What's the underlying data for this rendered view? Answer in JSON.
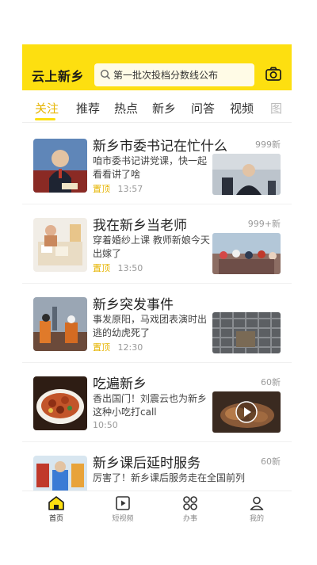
{
  "header": {
    "logo": "云上新乡",
    "search_text": "第一批次投档分数线公布"
  },
  "tabs": [
    "关注",
    "推荐",
    "热点",
    "新乡",
    "问答",
    "视频",
    "图"
  ],
  "feed": [
    {
      "title": "新乡市委书记在忙什么",
      "count": "999新",
      "desc": "咱市委书记讲党课，快一起看看讲了啥",
      "pin": "置顶",
      "time": "13:57"
    },
    {
      "title": "我在新乡当老师",
      "count": "999+新",
      "desc": "穿着婚纱上课 教师新娘今天出嫁了",
      "pin": "置顶",
      "time": "13:50"
    },
    {
      "title": "新乡突发事件",
      "count": "",
      "desc": "事发原阳，马戏团表演时出逃的幼虎死了",
      "pin": "置顶",
      "time": "12:30"
    },
    {
      "title": "吃遍新乡",
      "count": "60新",
      "desc": "香出国门！刘震云也为新乡这种小吃打call",
      "pin": "",
      "time": "10:50"
    },
    {
      "title": "新乡课后延时服务",
      "count": "60新",
      "desc": "厉害了！新乡课后服务走在全国前列",
      "pin": "",
      "time": ""
    }
  ],
  "bottom_nav": [
    "首页",
    "短视频",
    "办事",
    "我的"
  ],
  "colors": {
    "accent": "#fddf10",
    "accent_text": "#e6b400"
  }
}
